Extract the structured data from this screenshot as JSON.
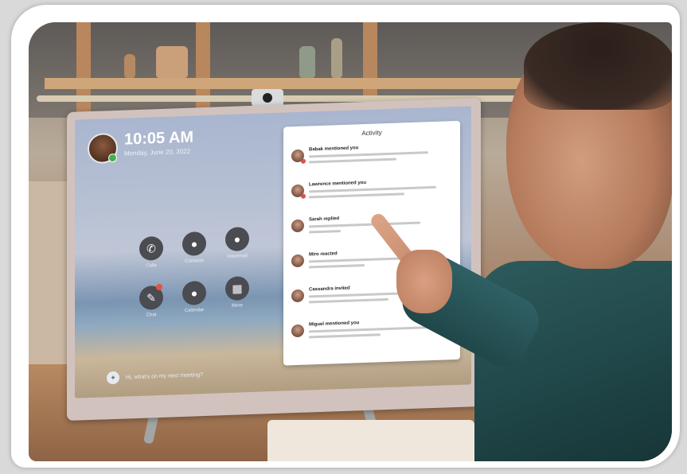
{
  "screen": {
    "time": "10:05 AM",
    "date": "Monday, June 20, 2022",
    "apps": [
      {
        "label": "Calls",
        "icon": "phone-icon",
        "glyph": "✆"
      },
      {
        "label": "Contacts",
        "icon": "person-icon",
        "glyph": "●"
      },
      {
        "label": "Voicemail",
        "icon": "person-icon",
        "glyph": "●"
      },
      {
        "label": "Chat",
        "icon": "chat-icon",
        "glyph": "✎"
      },
      {
        "label": "Calendar",
        "icon": "person-icon",
        "glyph": "●"
      },
      {
        "label": "More",
        "icon": "apps-icon",
        "glyph": "▦"
      }
    ],
    "ai_prompt": "Hi, what's on my next meeting?",
    "activity": {
      "title": "Activity",
      "items": [
        {
          "title": "Babak mentioned you"
        },
        {
          "title": "Lawrence mentioned you"
        },
        {
          "title": "Sarah replied"
        },
        {
          "title": "Miro reacted"
        },
        {
          "title": "Cassandra invited"
        },
        {
          "title": "Miguel mentioned you"
        }
      ]
    }
  }
}
